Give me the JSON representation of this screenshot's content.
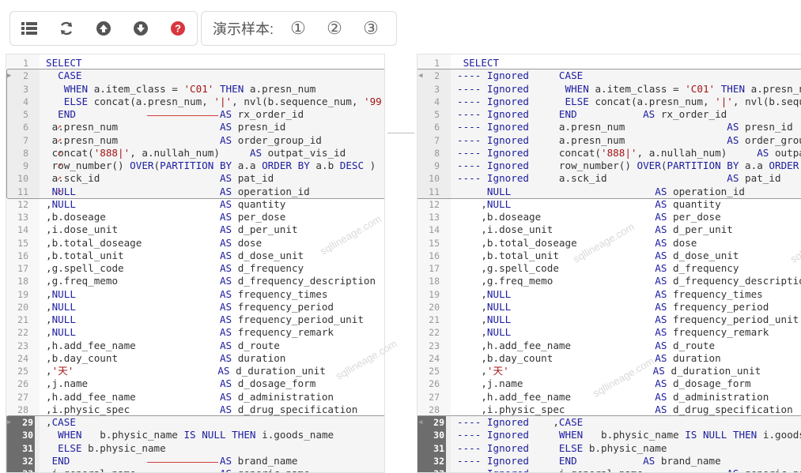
{
  "toolbar": {
    "icons": [
      "list-icon",
      "refresh-icon",
      "upload-icon",
      "download-icon",
      "help-icon"
    ],
    "help_color": "#d9363e"
  },
  "samples": {
    "label": "演示样本:",
    "buttons": [
      "①",
      "②",
      "③"
    ]
  },
  "watermark": "sqllineage.com",
  "left_lines": [
    "SELECT",
    "  CASE",
    "   WHEN a.item_class = 'C01' THEN a.presn_num",
    "   ELSE concat(a.presn_num, '|', nvl(b.sequence_num, '99",
    "  END                        AS rx_order_id",
    " a.presn_num                 AS presn_id",
    " a.presn_num                 AS order_group_id",
    " concat('888|', a.nullah_num)     AS outpat_vis_id",
    " row_number() OVER(PARTITION BY a.a ORDER BY a.b DESC )",
    " a.sck_id                    AS pat_id",
    " NULL                        AS operation_id",
    ",NULL                        AS quantity",
    ",b.doseage                   AS per_dose",
    ",i.dose_unit                 AS d_per_unit",
    ",b.total_doseage             AS dose",
    ",b.total_unit                AS d_dose_unit",
    ",g.spell_code                AS d_frequency",
    ",g.freq_memo                 AS d_frequency_description",
    ",NULL                        AS frequency_times",
    ",NULL                        AS frequency_period",
    ",NULL                        AS frequency_period_unit",
    ",NULL                        AS frequency_remark",
    ",h.add_fee_name              AS d_route",
    ",b.day_count                 AS duration",
    ",'天'                        AS d_duration_unit",
    ",j.name                      AS d_dosage_form",
    ",h.add_fee_name              AS d_administration",
    ",i.physic_spec               AS d_drug_specification",
    ",CASE",
    "  WHEN   b.physic_name IS NULL THEN i.goods_name",
    "  ELSE b.physic_name",
    " END                         AS brand_name",
    ",i.general_name              AS generic_name"
  ],
  "right_lines": [
    " SELECT",
    "---- Ignored     CASE",
    "---- Ignored      WHEN a.item_class = 'C01' THEN a.presn_nu",
    "---- Ignored      ELSE concat(a.presn_num, '|', nvl(b.seque",
    "---- Ignored     END           AS rx_order_id",
    "---- Ignored     a.presn_num                 AS presn_id",
    "---- Ignored     a.presn_num                 AS order_group_",
    "---- Ignored     concat('888|', a.nullah_num)     AS outpat",
    "---- Ignored     row_number() OVER(PARTITION BY a.a ORDER B",
    "---- Ignored     a.sck_id                    AS pat_id",
    "     NULL                        AS operation_id",
    "    ,NULL                        AS quantity",
    "    ,b.doseage                   AS per_dose",
    "    ,i.dose_unit                 AS d_per_unit",
    "    ,b.total_doseage             AS dose",
    "    ,b.total_unit                AS d_dose_unit",
    "    ,g.spell_code                AS d_frequency",
    "    ,g.freq_memo                 AS d_frequency_description",
    "    ,NULL                        AS frequency_times",
    "    ,NULL                        AS frequency_period",
    "    ,NULL                        AS frequency_period_unit",
    "    ,NULL                        AS frequency_remark",
    "    ,h.add_fee_name              AS d_route",
    "    ,b.day_count                 AS duration",
    "    ,'天'                        AS d_duration_unit",
    "    ,j.name                      AS d_dosage_form",
    "    ,h.add_fee_name              AS d_administration",
    "    ,i.physic_spec               AS d_drug_specification",
    "---- Ignored    ,CASE",
    "---- Ignored     WHEN   b.physic_name IS NULL THEN i.goods",
    "---- Ignored     ELSE b.physic_name",
    "---- Ignored     END           AS brand_name",
    "---- Ignored     i.general_name              AS generic_name"
  ],
  "left_selected_lines": [
    29,
    30,
    31,
    32,
    33
  ],
  "right_selected_lines": [
    29,
    30,
    31,
    32,
    33
  ]
}
